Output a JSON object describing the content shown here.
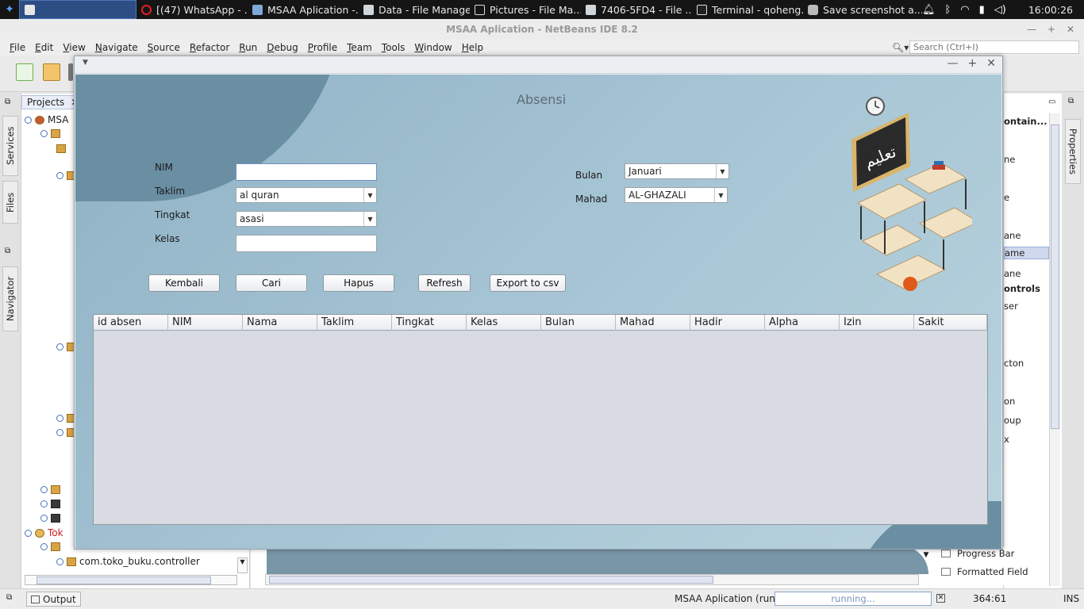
{
  "taskbar": {
    "items": [
      {
        "label": "",
        "icon": "java-icon"
      },
      {
        "label": "[(47) WhatsApp - ...",
        "icon": "opera-icon"
      },
      {
        "label": "MSAA Aplication -...",
        "icon": "cube-icon"
      },
      {
        "label": "Data - File Manager",
        "icon": "folder-icon"
      },
      {
        "label": "Pictures - File Ma...",
        "icon": "image-icon"
      },
      {
        "label": "7406-5FD4 - File ...",
        "icon": "folder-icon"
      },
      {
        "label": "Terminal - qoheng...",
        "icon": "terminal-icon"
      },
      {
        "label": "Save screenshot a...",
        "icon": "camera-icon"
      }
    ],
    "clock": "16:00:26"
  },
  "ide": {
    "title": "MSAA Aplication - NetBeans IDE 8.2",
    "menu": [
      "File",
      "Edit",
      "View",
      "Navigate",
      "Source",
      "Refactor",
      "Run",
      "Debug",
      "Profile",
      "Team",
      "Tools",
      "Window",
      "Help"
    ],
    "search_placeholder": "Search (Ctrl+I)",
    "projects_tab": "Projects",
    "side_tabs": {
      "services": "Services",
      "files": "Files",
      "navigator": "Navigator",
      "properties": "Properties"
    },
    "tree": {
      "root1": "MSA",
      "root2": "Tok",
      "package": "com.toko_buku.controller"
    },
    "palette": {
      "items": [
        "ontain...",
        "ne",
        "e",
        "ane",
        "ame",
        "ane",
        "ontrols",
        "ser",
        "cton",
        "on",
        "oup",
        "x"
      ],
      "bottom": [
        "Progress Bar",
        "Formatted Field"
      ]
    },
    "status": {
      "output": "Output",
      "run_label": "MSAA Aplication (run)",
      "progress": "running...",
      "position": "364:61",
      "mode": "INS"
    }
  },
  "form": {
    "title": "Absensi",
    "labels": {
      "nim": "NIM",
      "taklim": "Taklim",
      "tingkat": "Tingkat",
      "kelas": "Kelas",
      "bulan": "Bulan",
      "mahad": "Mahad"
    },
    "fields": {
      "nim": "",
      "taklim": "al quran",
      "tingkat": "asasi",
      "kelas": "",
      "bulan": "Januari",
      "mahad": "AL-GHAZALI"
    },
    "buttons": {
      "kembali": "Kembali",
      "cari": "Cari",
      "hapus": "Hapus",
      "refresh": "Refresh",
      "export": "Export to csv"
    },
    "table_columns": [
      "id absen",
      "NIM",
      "Nama",
      "Taklim",
      "Tingkat",
      "Kelas",
      "Bulan",
      "Mahad",
      "Hadir",
      "Alpha",
      "Izin",
      "Sakit"
    ],
    "illustration_text": "تعليم"
  }
}
